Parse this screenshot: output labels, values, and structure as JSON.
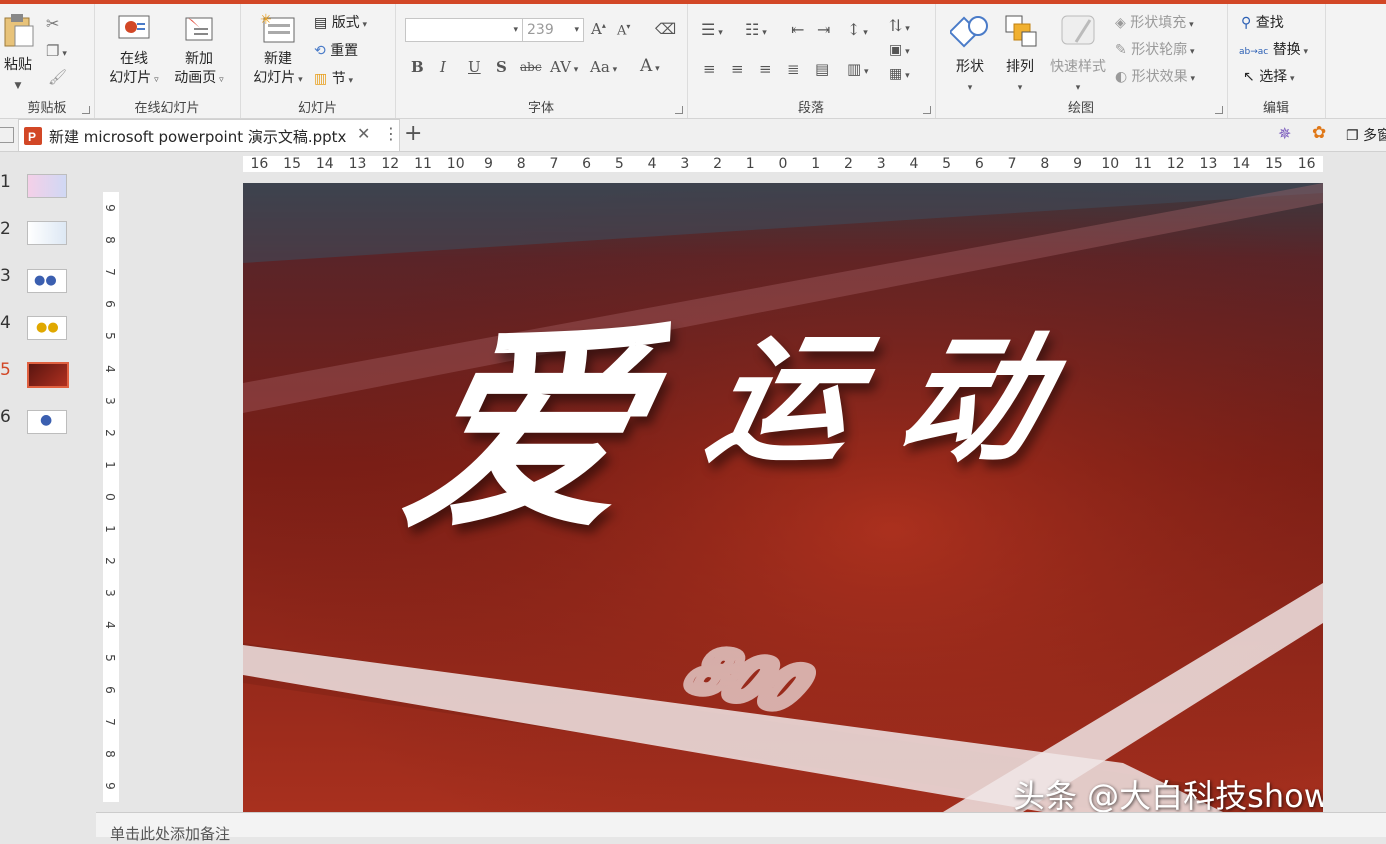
{
  "ribbon": {
    "clipboard": {
      "group_label": "剪贴板",
      "paste_label": "粘贴"
    },
    "online_slides": {
      "group_label": "在线幻灯片",
      "online_slide_label1": "在线",
      "online_slide_label2": "幻灯片",
      "new_anim_label1": "新加",
      "new_anim_label2": "动画页"
    },
    "slides": {
      "group_label": "幻灯片",
      "new_slide_label1": "新建",
      "new_slide_label2": "幻灯片",
      "layout_label": "版式",
      "reset_label": "重置",
      "section_label": "节"
    },
    "font": {
      "group_label": "字体",
      "font_name": "",
      "font_size": "239",
      "bold": "B",
      "italic": "I",
      "underline": "U",
      "shadow": "S",
      "strike": "abc",
      "spacing": "AV",
      "case": "Aa",
      "color": "A"
    },
    "paragraph": {
      "group_label": "段落"
    },
    "drawing": {
      "group_label": "绘图",
      "shapes_label": "形状",
      "arrange_label": "排列",
      "quick_styles_label": "快速样式",
      "fill_label": "形状填充",
      "outline_label": "形状轮廓",
      "effects_label": "形状效果"
    },
    "editing": {
      "group_label": "编辑",
      "find_label": "查找",
      "replace_label": "替换",
      "select_label": "选择",
      "replace_icon_text": "ab→ac"
    }
  },
  "tabs": {
    "doc_title": "新建 microsoft powerpoint 演示文稿.pptx",
    "right_label": "多窗"
  },
  "thumbnails": [
    {
      "num": "1"
    },
    {
      "num": "2"
    },
    {
      "num": "3"
    },
    {
      "num": "4"
    },
    {
      "num": "5"
    },
    {
      "num": "6"
    }
  ],
  "ruler": {
    "h_labels": [
      "16",
      "15",
      "14",
      "13",
      "12",
      "11",
      "10",
      "9",
      "8",
      "7",
      "6",
      "5",
      "4",
      "3",
      "2",
      "1",
      "0",
      "1",
      "2",
      "3",
      "4",
      "5",
      "6",
      "7",
      "8",
      "9",
      "10",
      "11",
      "12",
      "13",
      "14",
      "15",
      "16"
    ],
    "v_labels": [
      "9",
      "8",
      "7",
      "6",
      "5",
      "4",
      "3",
      "2",
      "1",
      "0",
      "1",
      "2",
      "3",
      "4",
      "5",
      "6",
      "7",
      "8",
      "9"
    ]
  },
  "slide": {
    "title_char1": "爱",
    "title_rest": "运 动",
    "track_number": "800",
    "watermark": "头条 @大白科技show"
  },
  "notes": {
    "placeholder": "单击此处添加备注"
  },
  "colors": {
    "accent": "#d24726",
    "track": "#a52a1a"
  }
}
